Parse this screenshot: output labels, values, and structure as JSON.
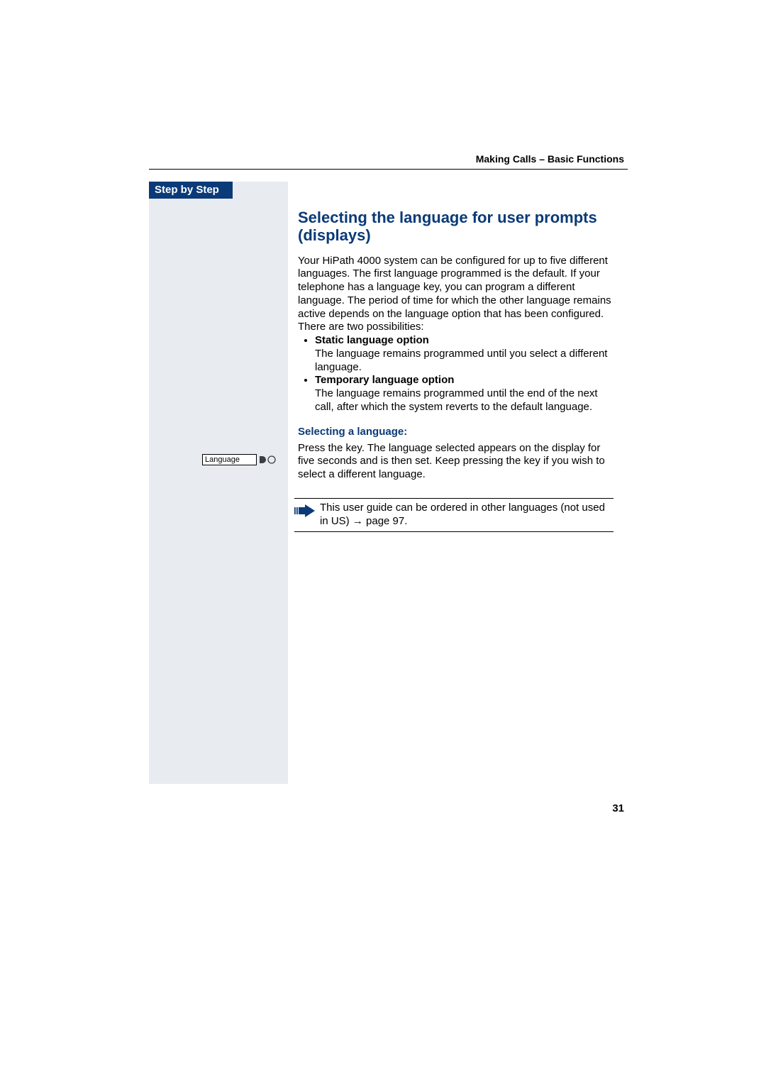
{
  "runningHead": "Making Calls – Basic Functions",
  "tabLabel": "Step by Step",
  "heading": "Selecting the language for user prompts (displays)",
  "intro": "Your HiPath 4000 system can be configured for up to five different languages. The first language programmed is the default. If your telephone has a language key, you can program a different language. The period of time for which the other language remains active depends on the language option that has been configured. There are two possibilities:",
  "options": [
    {
      "title": "Static language option",
      "desc": "The language remains programmed until you select a different language."
    },
    {
      "title": "Temporary language option",
      "desc": "The language remains programmed until the end of the next call, after which the system reverts to the default language."
    }
  ],
  "subheading": "Selecting a language:",
  "keyLabel": "Language",
  "pressText": "Press the key. The language selected appears on the display for five seconds and is then set. Keep pressing the key if you wish to select a different language.",
  "note": "This user guide can be ordered in other languages (not used in US) → page 97.",
  "pageNumber": "31"
}
